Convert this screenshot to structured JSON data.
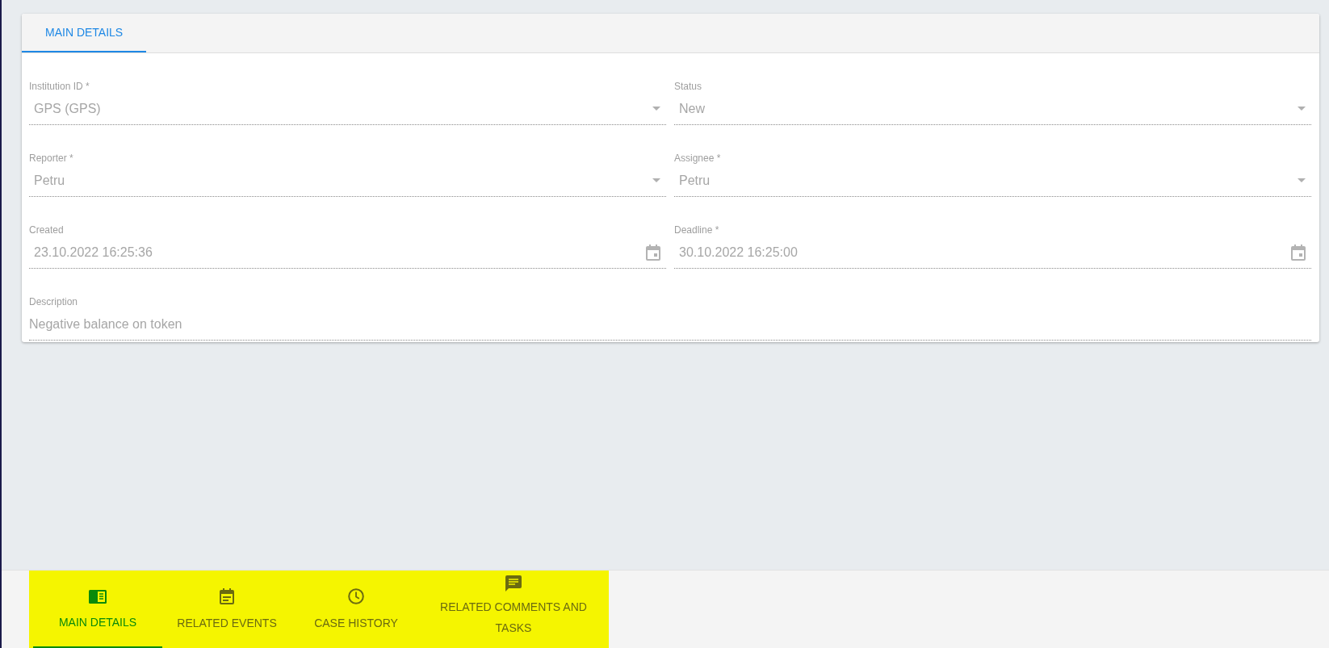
{
  "card": {
    "tabs": [
      {
        "label": "MAIN DETAILS",
        "selected": true
      }
    ],
    "fields": [
      {
        "kind": "select",
        "label": "Institution ID *",
        "value": "GPS (GPS)"
      },
      {
        "kind": "select",
        "label": "Status",
        "value": "New"
      },
      {
        "kind": "select",
        "label": "Reporter *",
        "value": "Petru"
      },
      {
        "kind": "select",
        "label": "Assignee *",
        "value": "Petru"
      },
      {
        "kind": "date",
        "label": "Created",
        "value": "23.10.2022 16:25:36"
      },
      {
        "kind": "date",
        "label": "Deadline *",
        "value": "30.10.2022 16:25:00"
      },
      {
        "kind": "text",
        "label": "Description",
        "value": "Negative balance on token"
      }
    ]
  },
  "bottom_nav": [
    {
      "label": "MAIN DETAILS",
      "selected": true
    },
    {
      "label": "RELATED EVENTS",
      "selected": false
    },
    {
      "label": "CASE HISTORY",
      "selected": false
    },
    {
      "label": "RELATED COMMENTS AND TASKS",
      "selected": false
    }
  ]
}
